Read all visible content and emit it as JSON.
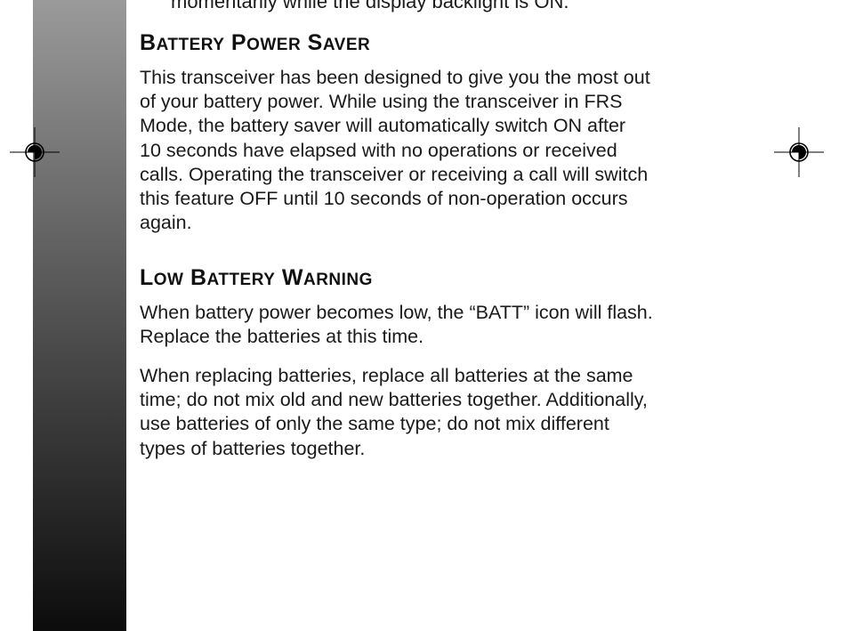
{
  "top_fragment": "momentarily while the display backlight is ON.",
  "sections": [
    {
      "heading_caps": [
        "B",
        "P",
        "S"
      ],
      "heading_rest": [
        "ATTERY",
        "OWER",
        "AVER"
      ],
      "paragraphs": [
        {
          "lines": [
            "This transceiver has been designed to give you the most out",
            "of your battery power.  While using the transceiver in FRS",
            "Mode, the battery saver will automatically switch ON after",
            "10 seconds have elapsed with no operations or received",
            "calls.  Operating the transceiver or receiving a call will switch",
            "this feature OFF until 10 seconds of non-operation occurs",
            "again."
          ]
        }
      ]
    },
    {
      "heading_caps": [
        "L",
        "B",
        "W"
      ],
      "heading_rest": [
        "OW",
        "ATTERY",
        "ARNING"
      ],
      "paragraphs": [
        {
          "lines": [
            "When battery power becomes low, the “BATT” icon will flash.",
            "Replace the batteries at this time."
          ]
        },
        {
          "lines": [
            "When replacing batteries, replace all batteries at the same",
            "time; do not mix old and new batteries together.  Additionally,",
            "use batteries of only the same type; do not mix different",
            "types of batteries together."
          ]
        }
      ]
    }
  ]
}
